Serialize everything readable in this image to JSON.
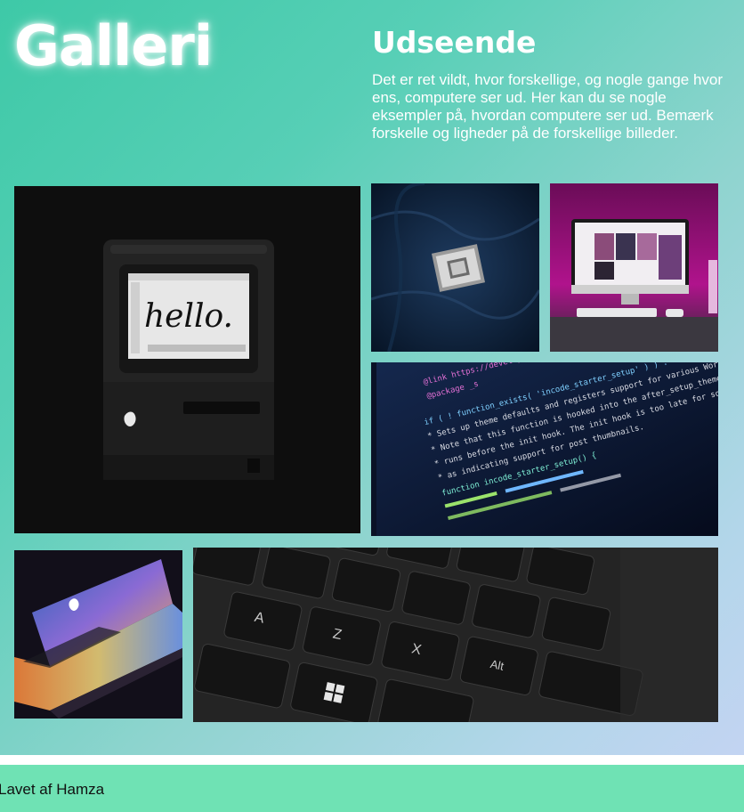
{
  "header": {
    "title": "Galleri"
  },
  "intro": {
    "heading": "Udseende",
    "text": "Det er ret vildt, hvor forskellige, og nogle gange hvor ens, computere ser ud. Her kan du se nogle eksempler på, hvordan computere ser ud. Bemærk forskelle og ligheder på de forskellige billeder."
  },
  "gallery": {
    "mac_screen_text": "hello.",
    "code_lines": [
      "@link https://developer",
      "@package _s",
      "if ( ! function_exists( 'incode_starter_setup' ) ) :",
      "* Sets up theme defaults and registers support for various WordPress features.",
      "* Note that this function is hooked into the after_setup_theme hook, which",
      "* runs before the init hook. The init hook is too late for some features,",
      "* as indicating support for post thumbnails.",
      "function incode_starter_setup() {"
    ],
    "key_labels": [
      "A",
      "Z",
      "X",
      "Alt"
    ]
  },
  "footer": {
    "text": "Lavet af Hamza"
  },
  "colors": {
    "gradient_start": "#3ec9a7",
    "gradient_end": "#c3d4f2",
    "footer_bg": "#6fe2b4",
    "title_text": "#ffffff"
  }
}
